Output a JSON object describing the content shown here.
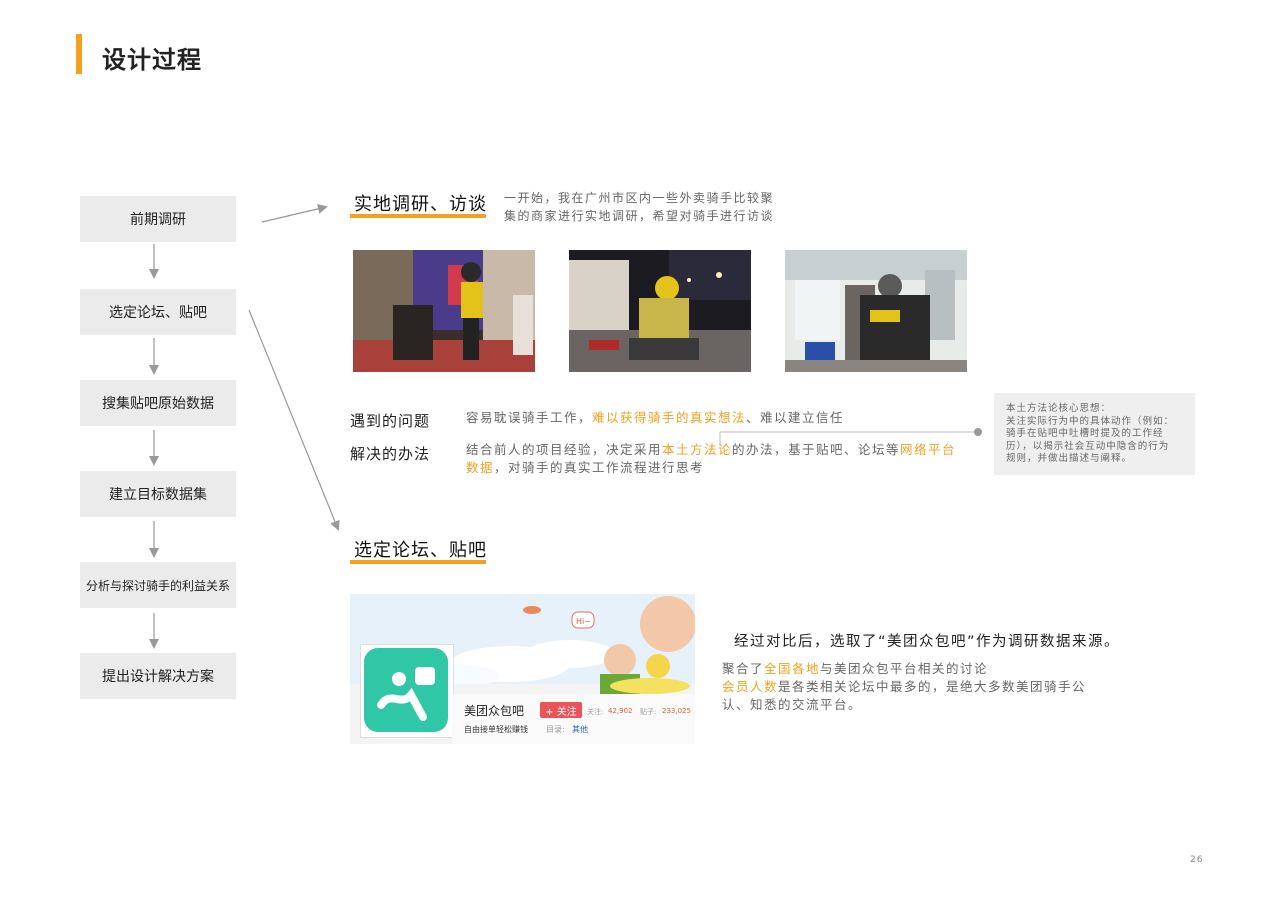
{
  "page": {
    "title": "设计过程",
    "page_number": "26",
    "accent_color": "#f2a11e"
  },
  "flow": {
    "steps": [
      "前期调研",
      "选定论坛、贴吧",
      "搜集贴吧原始数据",
      "建立目标数据集",
      "分析与探讨骑手的利益关系",
      "提出设计解决方案"
    ]
  },
  "section1": {
    "title": "实地调研、访谈",
    "desc_line1": "一开始，我在广州市区内一些外卖骑手比较聚",
    "desc_line2": "集的商家进行实地调研，希望对骑手进行访谈",
    "problem_label": "遇到的问题",
    "problem_text_1": "容易耽误骑手工作，",
    "problem_text_hl": "难以获得骑手的真实想法",
    "problem_text_2": "、难以建立信任",
    "solution_label": "解决的办法",
    "solution_text_1": "结合前人的项目经验，决定采用",
    "solution_hl_1": "本土方法论",
    "solution_text_2": "的办法，基于贴吧、论坛等",
    "solution_hl_2": "网络平台",
    "solution_hl_3": "数据",
    "solution_text_3": "，对骑手的真实工作流程进行思考",
    "note_lines": [
      "本土方法论核心思想：",
      "关注实际行为中的具体动作（例如：",
      "骑手在贴吧中吐槽时提及的工作经",
      "历），以揭示社会互动中隐含的行为",
      "规则，并做出描述与阐释。"
    ]
  },
  "section2": {
    "title": "选定论坛、贴吧",
    "summary": "经过对比后，选取了“美团众包吧”作为调研数据来源。",
    "detail_hl_1": "全国各地",
    "detail_1": "聚合了",
    "detail_2": "与美团众包平台相关的讨论",
    "detail_hl_2": "会员人数",
    "detail_3": "是各类相关论坛中最多的，是绝大多数美团骑手公",
    "detail_4": "认、知悉的交流平台。"
  },
  "banner": {
    "forum_name": "美团众包吧",
    "follow_button": "+ 关注",
    "follow_label": "关注:",
    "follow_count": "42,902",
    "posts_label": "贴子:",
    "posts_count": "233,025",
    "slogan": "自由接单轻松赚钱",
    "category_label": "目录:",
    "category_value": "其他",
    "bubble_text": "Hi~"
  }
}
